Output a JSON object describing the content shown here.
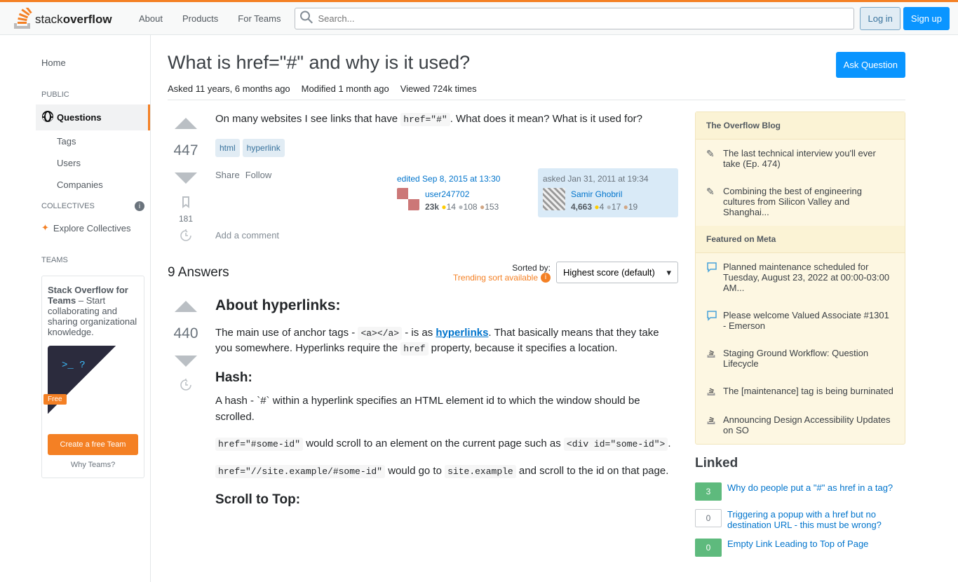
{
  "header": {
    "nav": {
      "about": "About",
      "products": "Products",
      "for_teams": "For Teams"
    },
    "search_placeholder": "Search...",
    "login": "Log in",
    "signup": "Sign up"
  },
  "left_nav": {
    "home": "Home",
    "public": "PUBLIC",
    "questions": "Questions",
    "tags": "Tags",
    "users": "Users",
    "companies": "Companies",
    "collectives": "COLLECTIVES",
    "explore": "Explore Collectives",
    "teams": "TEAMS",
    "teams_title": "Stack Overflow for Teams",
    "teams_desc": " – Start collaborating and sharing organizational knowledge.",
    "teams_free": "Free",
    "create_team": "Create a free Team",
    "why_teams": "Why Teams?"
  },
  "question": {
    "title": "What is href=\"#\" and why is it used?",
    "ask_button": "Ask Question",
    "asked_label": "Asked",
    "asked_value": "11 years, 6 months ago",
    "modified_label": "Modified",
    "modified_value": "1 month ago",
    "viewed_label": "Viewed",
    "viewed_value": "724k times",
    "votes": "447",
    "bookmarks": "181",
    "body_pre": "On many websites I see links that have ",
    "body_code": "href=\"#\"",
    "body_post": ". What does it mean? What is it used for?",
    "tags": [
      "html",
      "hyperlink"
    ],
    "share": "Share",
    "follow": "Follow",
    "edited_prefix": "edited ",
    "edited_time": "Sep 8, 2015 at 13:30",
    "editor_name": "user247702",
    "editor_rep": "23k",
    "editor_gold": "14",
    "editor_silver": "108",
    "editor_bronze": "153",
    "asked_prefix": "asked ",
    "asked_time": "Jan 31, 2011 at 19:34",
    "asker_name": "Samir Ghobril",
    "asker_rep": "4,663",
    "asker_gold": "4",
    "asker_silver": "17",
    "asker_bronze": "19",
    "add_comment": "Add a comment"
  },
  "answers": {
    "count": "9 Answers",
    "sorted_by": "Sorted by:",
    "trending": "Trending sort available",
    "sort_value": "Highest score (default)",
    "top": {
      "votes": "440",
      "h1": "About hyperlinks:",
      "p1_pre": "The main use of anchor tags - ",
      "p1_code1": "<a></a>",
      "p1_mid": " - is as ",
      "p1_link": "hyperlinks",
      "p1_post": ". That basically means that they take you somewhere. Hyperlinks require the ",
      "p1_code2": "href",
      "p1_end": " property, because it specifies a location.",
      "h2": "Hash:",
      "p2": "A hash - `#` within a hyperlink specifies an HTML element id to which the window should be scrolled.",
      "p3_code1": "href=\"#some-id\"",
      "p3_mid": " would scroll to an element on the current page such as ",
      "p3_code2": "<div id=\"some-id\">",
      "p3_end": ".",
      "p4_code1": "href=\"//site.example/#some-id\"",
      "p4_mid": " would go to ",
      "p4_code2": "site.example",
      "p4_end": " and scroll to the id on that page.",
      "h3": "Scroll to Top:"
    }
  },
  "sidebar": {
    "blog_header": "The Overflow Blog",
    "blog": [
      "The last technical interview you'll ever take (Ep. 474)",
      "Combining the best of engineering cultures from Silicon Valley and Shanghai..."
    ],
    "meta_header": "Featured on Meta",
    "meta": [
      "Planned maintenance scheduled for Tuesday, August 23, 2022 at 00:00-03:00 AM...",
      "Please welcome Valued Associate #1301 - Emerson",
      "Staging Ground Workflow: Question Lifecycle",
      "The [maintenance] tag is being burninated",
      "Announcing Design Accessibility Updates on SO"
    ],
    "linked_header": "Linked",
    "linked": [
      {
        "score": "3",
        "answered": true,
        "text": "Why do people put a \"#\" as href in a tag?"
      },
      {
        "score": "0",
        "answered": false,
        "text": "Triggering a popup with a href but no destination URL - this must be wrong?"
      },
      {
        "score": "0",
        "answered": true,
        "text": "Empty Link Leading to Top of Page"
      }
    ]
  }
}
